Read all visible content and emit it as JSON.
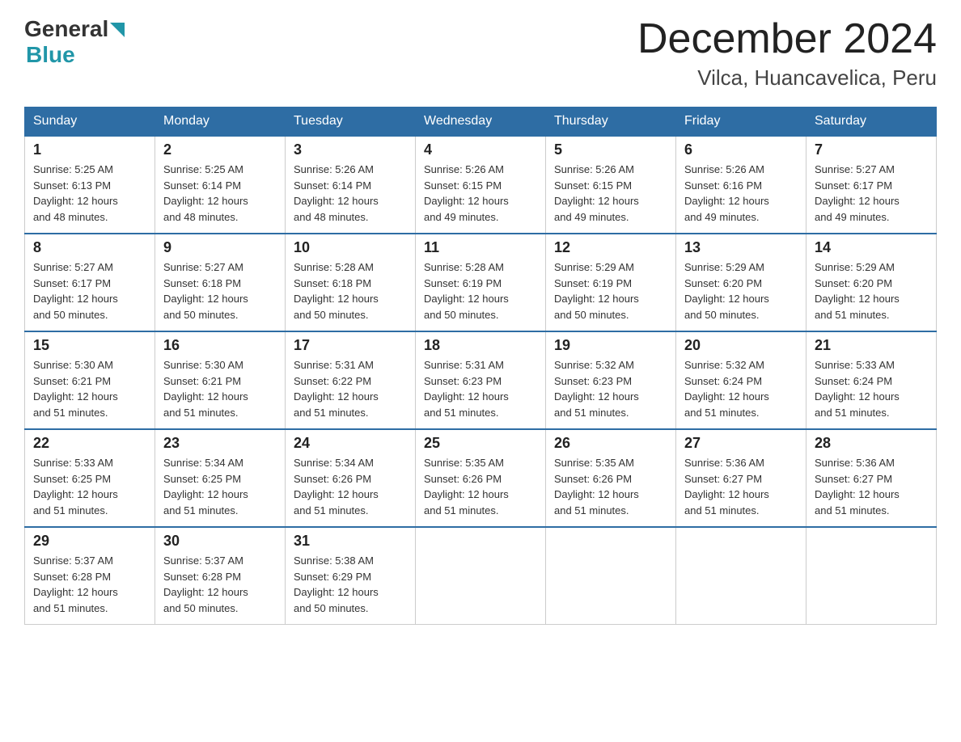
{
  "header": {
    "logo_general": "General",
    "logo_blue": "Blue",
    "month_title": "December 2024",
    "location": "Vilca, Huancavelica, Peru"
  },
  "days_of_week": [
    "Sunday",
    "Monday",
    "Tuesday",
    "Wednesday",
    "Thursday",
    "Friday",
    "Saturday"
  ],
  "weeks": [
    [
      {
        "day": "1",
        "sunrise": "5:25 AM",
        "sunset": "6:13 PM",
        "daylight": "12 hours and 48 minutes."
      },
      {
        "day": "2",
        "sunrise": "5:25 AM",
        "sunset": "6:14 PM",
        "daylight": "12 hours and 48 minutes."
      },
      {
        "day": "3",
        "sunrise": "5:26 AM",
        "sunset": "6:14 PM",
        "daylight": "12 hours and 48 minutes."
      },
      {
        "day": "4",
        "sunrise": "5:26 AM",
        "sunset": "6:15 PM",
        "daylight": "12 hours and 49 minutes."
      },
      {
        "day": "5",
        "sunrise": "5:26 AM",
        "sunset": "6:15 PM",
        "daylight": "12 hours and 49 minutes."
      },
      {
        "day": "6",
        "sunrise": "5:26 AM",
        "sunset": "6:16 PM",
        "daylight": "12 hours and 49 minutes."
      },
      {
        "day": "7",
        "sunrise": "5:27 AM",
        "sunset": "6:17 PM",
        "daylight": "12 hours and 49 minutes."
      }
    ],
    [
      {
        "day": "8",
        "sunrise": "5:27 AM",
        "sunset": "6:17 PM",
        "daylight": "12 hours and 50 minutes."
      },
      {
        "day": "9",
        "sunrise": "5:27 AM",
        "sunset": "6:18 PM",
        "daylight": "12 hours and 50 minutes."
      },
      {
        "day": "10",
        "sunrise": "5:28 AM",
        "sunset": "6:18 PM",
        "daylight": "12 hours and 50 minutes."
      },
      {
        "day": "11",
        "sunrise": "5:28 AM",
        "sunset": "6:19 PM",
        "daylight": "12 hours and 50 minutes."
      },
      {
        "day": "12",
        "sunrise": "5:29 AM",
        "sunset": "6:19 PM",
        "daylight": "12 hours and 50 minutes."
      },
      {
        "day": "13",
        "sunrise": "5:29 AM",
        "sunset": "6:20 PM",
        "daylight": "12 hours and 50 minutes."
      },
      {
        "day": "14",
        "sunrise": "5:29 AM",
        "sunset": "6:20 PM",
        "daylight": "12 hours and 51 minutes."
      }
    ],
    [
      {
        "day": "15",
        "sunrise": "5:30 AM",
        "sunset": "6:21 PM",
        "daylight": "12 hours and 51 minutes."
      },
      {
        "day": "16",
        "sunrise": "5:30 AM",
        "sunset": "6:21 PM",
        "daylight": "12 hours and 51 minutes."
      },
      {
        "day": "17",
        "sunrise": "5:31 AM",
        "sunset": "6:22 PM",
        "daylight": "12 hours and 51 minutes."
      },
      {
        "day": "18",
        "sunrise": "5:31 AM",
        "sunset": "6:23 PM",
        "daylight": "12 hours and 51 minutes."
      },
      {
        "day": "19",
        "sunrise": "5:32 AM",
        "sunset": "6:23 PM",
        "daylight": "12 hours and 51 minutes."
      },
      {
        "day": "20",
        "sunrise": "5:32 AM",
        "sunset": "6:24 PM",
        "daylight": "12 hours and 51 minutes."
      },
      {
        "day": "21",
        "sunrise": "5:33 AM",
        "sunset": "6:24 PM",
        "daylight": "12 hours and 51 minutes."
      }
    ],
    [
      {
        "day": "22",
        "sunrise": "5:33 AM",
        "sunset": "6:25 PM",
        "daylight": "12 hours and 51 minutes."
      },
      {
        "day": "23",
        "sunrise": "5:34 AM",
        "sunset": "6:25 PM",
        "daylight": "12 hours and 51 minutes."
      },
      {
        "day": "24",
        "sunrise": "5:34 AM",
        "sunset": "6:26 PM",
        "daylight": "12 hours and 51 minutes."
      },
      {
        "day": "25",
        "sunrise": "5:35 AM",
        "sunset": "6:26 PM",
        "daylight": "12 hours and 51 minutes."
      },
      {
        "day": "26",
        "sunrise": "5:35 AM",
        "sunset": "6:26 PM",
        "daylight": "12 hours and 51 minutes."
      },
      {
        "day": "27",
        "sunrise": "5:36 AM",
        "sunset": "6:27 PM",
        "daylight": "12 hours and 51 minutes."
      },
      {
        "day": "28",
        "sunrise": "5:36 AM",
        "sunset": "6:27 PM",
        "daylight": "12 hours and 51 minutes."
      }
    ],
    [
      {
        "day": "29",
        "sunrise": "5:37 AM",
        "sunset": "6:28 PM",
        "daylight": "12 hours and 51 minutes."
      },
      {
        "day": "30",
        "sunrise": "5:37 AM",
        "sunset": "6:28 PM",
        "daylight": "12 hours and 50 minutes."
      },
      {
        "day": "31",
        "sunrise": "5:38 AM",
        "sunset": "6:29 PM",
        "daylight": "12 hours and 50 minutes."
      },
      null,
      null,
      null,
      null
    ]
  ],
  "labels": {
    "sunrise": "Sunrise:",
    "sunset": "Sunset:",
    "daylight": "Daylight:"
  }
}
